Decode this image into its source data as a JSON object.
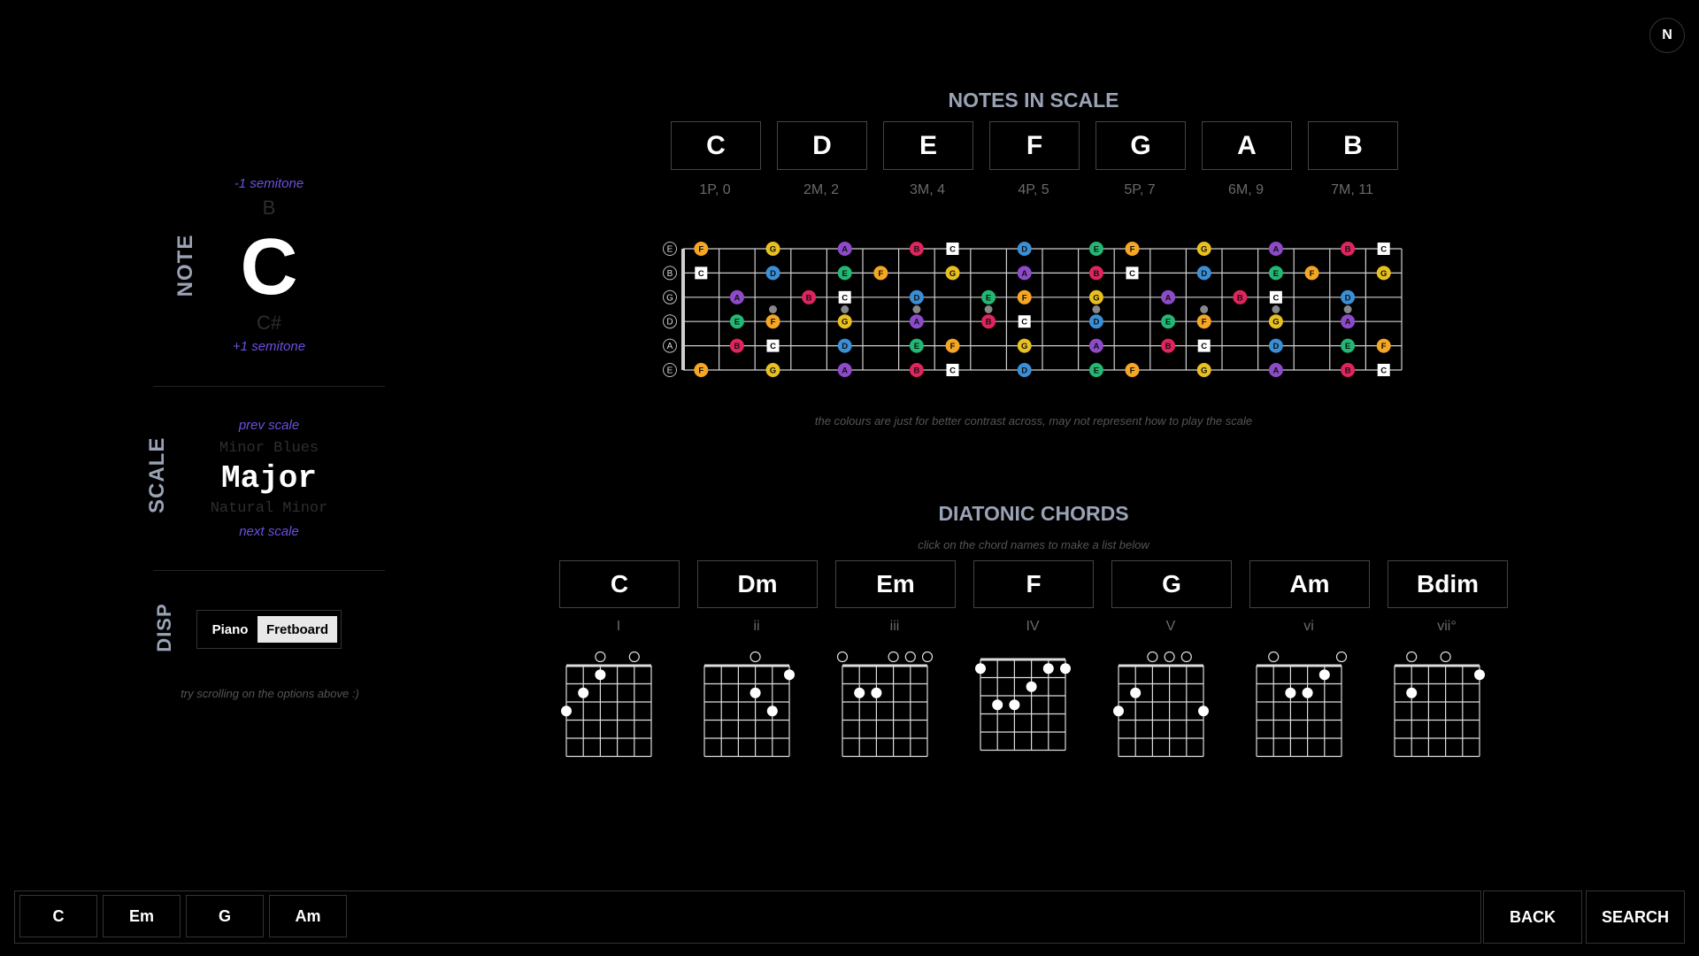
{
  "avatar": {
    "letter": "N"
  },
  "note_selector": {
    "label": "NOTE",
    "prev_hint": "-1 semitone",
    "prev": "B",
    "current": "C",
    "next": "C#",
    "next_hint": "+1 semitone"
  },
  "scale_selector": {
    "label": "SCALE",
    "prev_hint": "prev scale",
    "prev": "Minor Blues",
    "current": "Major",
    "next": "Natural Minor",
    "next_hint": "next scale"
  },
  "display": {
    "label": "DISP",
    "options": [
      "Piano",
      "Fretboard"
    ],
    "selected": "Fretboard",
    "hint": "try scrolling on the options above :)"
  },
  "notes_in_scale": {
    "title": "NOTES IN SCALE",
    "notes": [
      {
        "name": "C",
        "interval": "1P, 0"
      },
      {
        "name": "D",
        "interval": "2M, 2"
      },
      {
        "name": "E",
        "interval": "3M, 4"
      },
      {
        "name": "F",
        "interval": "4P, 5"
      },
      {
        "name": "G",
        "interval": "5P, 7"
      },
      {
        "name": "A",
        "interval": "6M, 9"
      },
      {
        "name": "B",
        "interval": "7M, 11"
      }
    ]
  },
  "fretboard": {
    "strings": [
      "E",
      "B",
      "G",
      "D",
      "A",
      "E"
    ],
    "note_colors": {
      "C": "#ffffff",
      "D": "#3b8fd6",
      "E": "#22b873",
      "F": "#f5a623",
      "G": "#e8c020",
      "A": "#8e4bc9",
      "B": "#e0245e"
    },
    "note": "the colours are just for better contrast across, may not represent how to play the scale"
  },
  "diatonic_chords": {
    "title": "DIATONIC CHORDS",
    "hint": "click on the chord names to make a list below",
    "chords": [
      {
        "name": "C",
        "roman": "I",
        "open": [
          2,
          4
        ],
        "muted": [],
        "barre": false,
        "dots": [
          [
            4,
            1
          ],
          [
            5,
            2
          ],
          [
            6,
            3
          ]
        ]
      },
      {
        "name": "Dm",
        "roman": "ii",
        "open": [
          3
        ],
        "muted": [],
        "barre": false,
        "dots": [
          [
            1,
            1
          ],
          [
            2,
            3
          ],
          [
            3,
            2
          ]
        ]
      },
      {
        "name": "Em",
        "roman": "iii",
        "open": [
          1,
          2,
          3,
          6
        ],
        "muted": [],
        "barre": false,
        "dots": [
          [
            4,
            2
          ],
          [
            5,
            2
          ]
        ]
      },
      {
        "name": "F",
        "roman": "IV",
        "open": [],
        "muted": [],
        "barre": true,
        "dots": [
          [
            1,
            1
          ],
          [
            2,
            1
          ],
          [
            6,
            1
          ],
          [
            3,
            2
          ],
          [
            4,
            3
          ],
          [
            5,
            3
          ]
        ]
      },
      {
        "name": "G",
        "roman": "V",
        "open": [
          2,
          3,
          4
        ],
        "muted": [],
        "barre": false,
        "dots": [
          [
            1,
            3
          ],
          [
            5,
            2
          ],
          [
            6,
            3
          ]
        ]
      },
      {
        "name": "Am",
        "roman": "vi",
        "open": [
          1,
          5
        ],
        "muted": [],
        "barre": false,
        "dots": [
          [
            2,
            1
          ],
          [
            3,
            2
          ],
          [
            4,
            2
          ]
        ]
      },
      {
        "name": "Bdim",
        "roman": "vii°",
        "open": [
          3,
          5
        ],
        "muted": [],
        "barre": false,
        "dots": [
          [
            1,
            1
          ],
          [
            5,
            2
          ]
        ]
      }
    ]
  },
  "chord_list": [
    "C",
    "Em",
    "G",
    "Am"
  ],
  "buttons": {
    "back": "BACK",
    "search": "SEARCH"
  }
}
